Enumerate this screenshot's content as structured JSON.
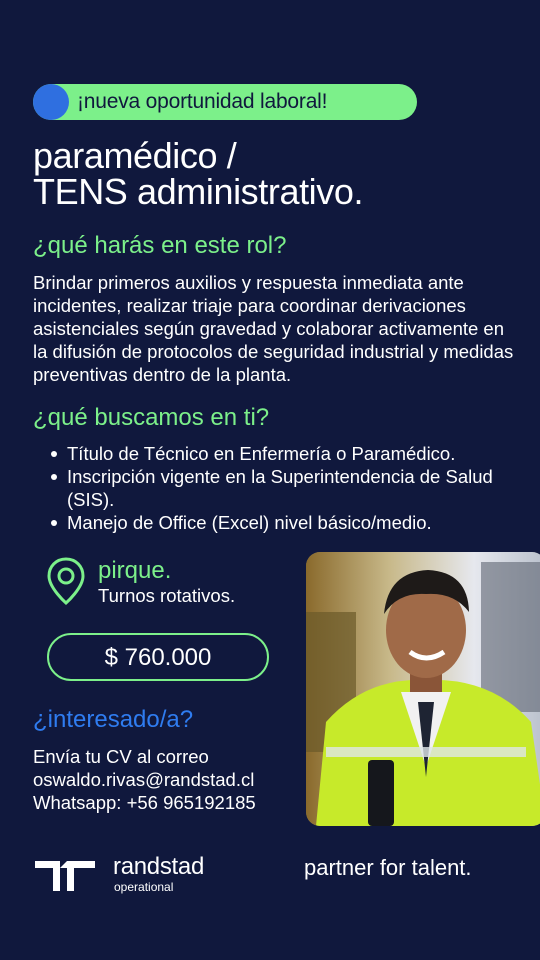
{
  "badge": {
    "text": "¡nueva oportunidad laboral!"
  },
  "title": {
    "line1": "paramédico /",
    "line2": "TENS administrativo."
  },
  "role": {
    "heading": "¿qué harás en este rol?",
    "description": "Brindar primeros auxilios y respuesta inmediata ante incidentes, realizar triaje para coordinar derivaciones asistenciales según gravedad y colaborar activamente en la difusión de protocolos de seguridad industrial y medidas preventivas dentro de la planta."
  },
  "requirements": {
    "heading": "¿qué buscamos en ti?",
    "items": [
      "Título de Técnico en Enfermería o Paramédico.",
      "Inscripción vigente en la Superintendencia de Salud (SIS).",
      "Manejo de Office (Excel) nivel básico/medio."
    ]
  },
  "location": {
    "icon": "location-pin-icon",
    "city": "pirque.",
    "shift": "Turnos rotativos."
  },
  "salary": {
    "amount": "$ 760.000"
  },
  "contact": {
    "heading": "¿interesado/a?",
    "line1": "Envía tu CV al correo",
    "email": "oswaldo.rivas@randstad.cl",
    "whatsapp": "Whatsapp: +56 965192185"
  },
  "footer": {
    "brand": "randstad",
    "sub": "operational",
    "tagline": "partner for talent."
  },
  "colors": {
    "background": "#10183d",
    "accent_green": "#7cf08a",
    "accent_blue": "#2f7cf0"
  }
}
